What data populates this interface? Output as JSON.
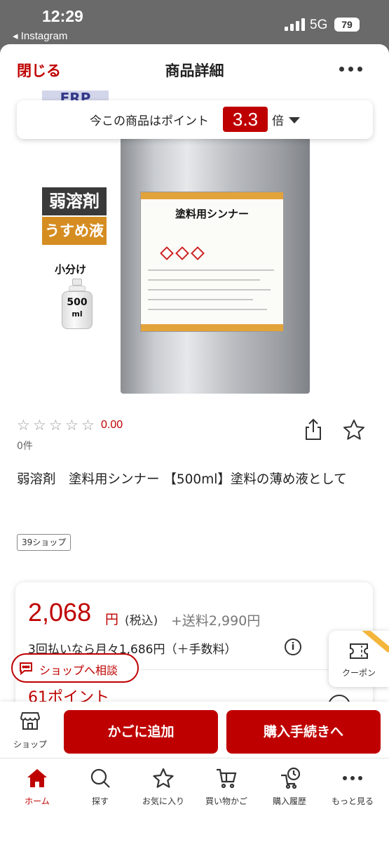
{
  "status_bar": {
    "time": "12:29",
    "back_app": "◂ Instagram",
    "network": "5G",
    "battery": "79"
  },
  "header": {
    "close_label": "閉じる",
    "title": "商品詳細",
    "more_icon": "more-icon"
  },
  "points_banner": {
    "text": "今この商品はポイント",
    "rate": "3.3",
    "suffix": "倍"
  },
  "product_image": {
    "brand_badge": "FRP",
    "tag_1": "弱溶剤",
    "tag_2": "うすめ液",
    "subdivide_label": "小分け",
    "bottle_label": "500",
    "bottle_unit": "ml",
    "can_label": "塗料用シンナー"
  },
  "rating": {
    "score": "0.00",
    "review_count": "0件",
    "stars": 0,
    "max_stars": 5
  },
  "product": {
    "title": "弱溶剤　塗料用シンナー 【500ml】塗料の薄め液として",
    "shop_tag": "39ショップ"
  },
  "price": {
    "amount": "2,068",
    "yen": "円",
    "tax": "(税込)",
    "shipping": "+送料2,990円",
    "installment": "3回払いなら月々1,686円（＋手数料）",
    "points": "61ポイント"
  },
  "floating": {
    "consult_label": "ショップへ相談",
    "coupon_label": "クーポン"
  },
  "actions": {
    "shop_label": "ショップ",
    "cart_label": "かごに追加",
    "buy_label": "購入手続きへ"
  },
  "tabs": [
    {
      "label": "ホーム",
      "icon": "home-icon",
      "active": true
    },
    {
      "label": "探す",
      "icon": "search-icon",
      "active": false
    },
    {
      "label": "お気に入り",
      "icon": "star-icon",
      "active": false
    },
    {
      "label": "買い物かご",
      "icon": "cart-icon",
      "active": false
    },
    {
      "label": "購入履歴",
      "icon": "history-icon",
      "active": false
    },
    {
      "label": "もっと見る",
      "icon": "more-icon",
      "active": false
    }
  ],
  "colors": {
    "accent": "#bf0000",
    "coupon_corner": "#f3b53b"
  }
}
